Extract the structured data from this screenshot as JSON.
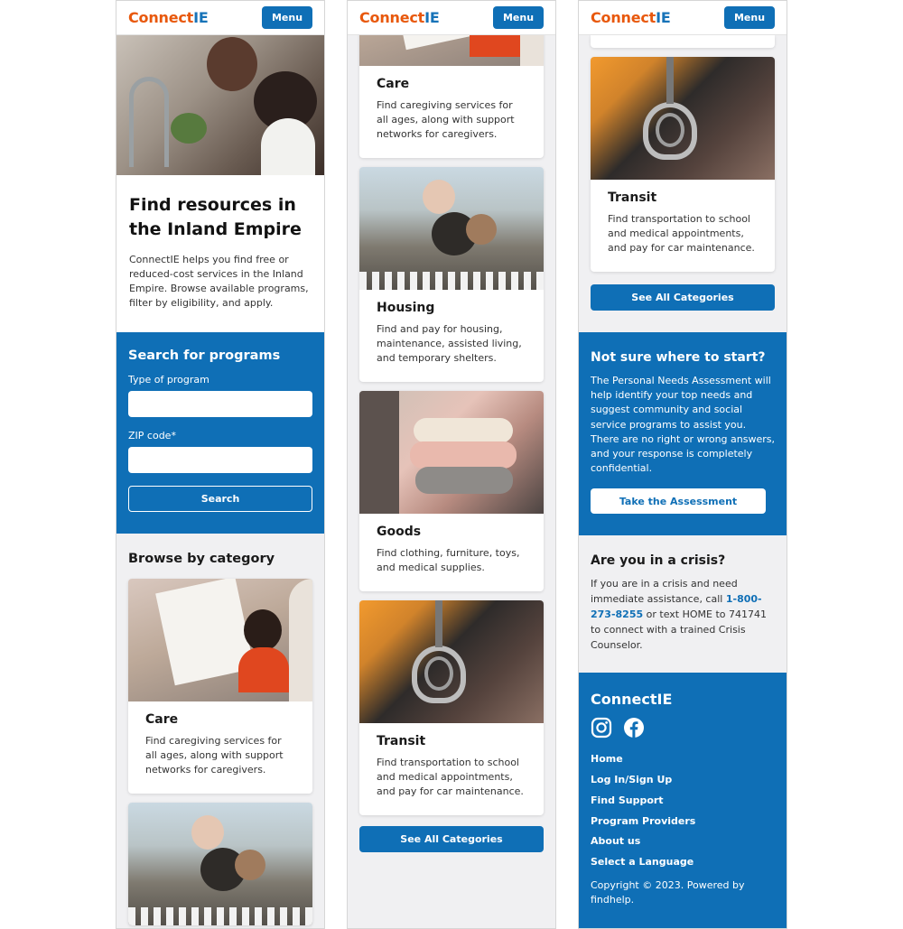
{
  "brand": {
    "name_part1": "Connect",
    "name_part2": "IE",
    "menu_label": "Menu"
  },
  "colors": {
    "primary": "#0f6fb6",
    "logo_orange": "#e8580c",
    "logo_blue": "#1773b8",
    "background_gray": "#f0f0f2"
  },
  "hero": {
    "title": "Find resources in the Inland Empire",
    "body": "ConnectIE helps you find free or reduced-cost services in the Inland Empire. Browse available programs, filter by eligibility, and apply."
  },
  "search": {
    "title": "Search for programs",
    "type_label": "Type of program",
    "type_value": "",
    "zip_label": "ZIP code*",
    "zip_value": "",
    "button_label": "Search"
  },
  "browse": {
    "title": "Browse by category",
    "categories": [
      {
        "title": "Care",
        "description": "Find caregiving services for all ages, along with support networks for caregivers."
      },
      {
        "title": "Housing",
        "description": "Find and pay for housing, maintenance, assisted living, and temporary shelters."
      },
      {
        "title": "Goods",
        "description": "Find clothing, furniture, toys, and medical supplies."
      },
      {
        "title": "Transit",
        "description": "Find transportation to school and medical appointments, and pay for car maintenance."
      }
    ],
    "see_all_label": "See All Categories"
  },
  "assessment": {
    "title": "Not sure where to start?",
    "body": "The Personal Needs Assessment will help identify your top needs and suggest community and social service programs to assist you. There are no right or wrong answers, and your response is completely confidential.",
    "button_label": "Take the Assessment"
  },
  "crisis": {
    "title": "Are you in a crisis?",
    "body_before": "If you are in a crisis and need immediate assistance, call",
    "phone": "1-800-273-8255",
    "body_after": "or text HOME to 741741 to connect with a trained Crisis Counselor."
  },
  "footer": {
    "logo": "ConnectIE",
    "social_icons": [
      "instagram-icon",
      "facebook-icon"
    ],
    "links": [
      "Home",
      "Log In/Sign Up",
      "Find Support",
      "Program Providers",
      "About us",
      "Select a Language"
    ],
    "copyright": "Copyright © 2023. Powered by findhelp."
  }
}
